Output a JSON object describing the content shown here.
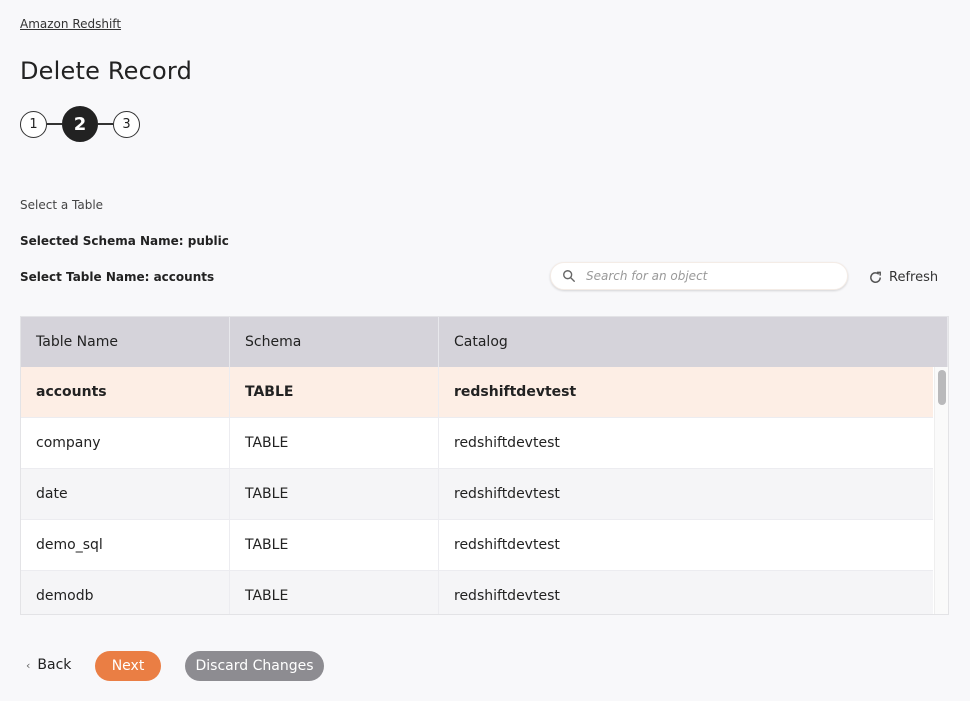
{
  "breadcrumb": "Amazon Redshift",
  "page_title": "Delete Record",
  "stepper": {
    "steps": [
      "1",
      "2",
      "3"
    ],
    "active_step": 2
  },
  "section_label": "Select a Table",
  "selected_schema": "Selected Schema Name: public",
  "selected_table": "Select Table Name: accounts",
  "search": {
    "placeholder": "Search for an object",
    "value": ""
  },
  "refresh_label": "Refresh",
  "table": {
    "columns": [
      "Table Name",
      "Schema",
      "Catalog"
    ],
    "rows": [
      {
        "name": "accounts",
        "schema": "TABLE",
        "catalog": "redshiftdevtest",
        "selected": true
      },
      {
        "name": "company",
        "schema": "TABLE",
        "catalog": "redshiftdevtest",
        "selected": false
      },
      {
        "name": "date",
        "schema": "TABLE",
        "catalog": "redshiftdevtest",
        "selected": false
      },
      {
        "name": "demo_sql",
        "schema": "TABLE",
        "catalog": "redshiftdevtest",
        "selected": false
      },
      {
        "name": "demodb",
        "schema": "TABLE",
        "catalog": "redshiftdevtest",
        "selected": false
      }
    ]
  },
  "footer": {
    "back_label": "Back",
    "next_label": "Next",
    "discard_label": "Discard Changes"
  },
  "colors": {
    "accent": "#ea7e44",
    "selected_row": "#fdeee5",
    "header_bg": "#d5d3da",
    "discard": "#8d8c91"
  }
}
